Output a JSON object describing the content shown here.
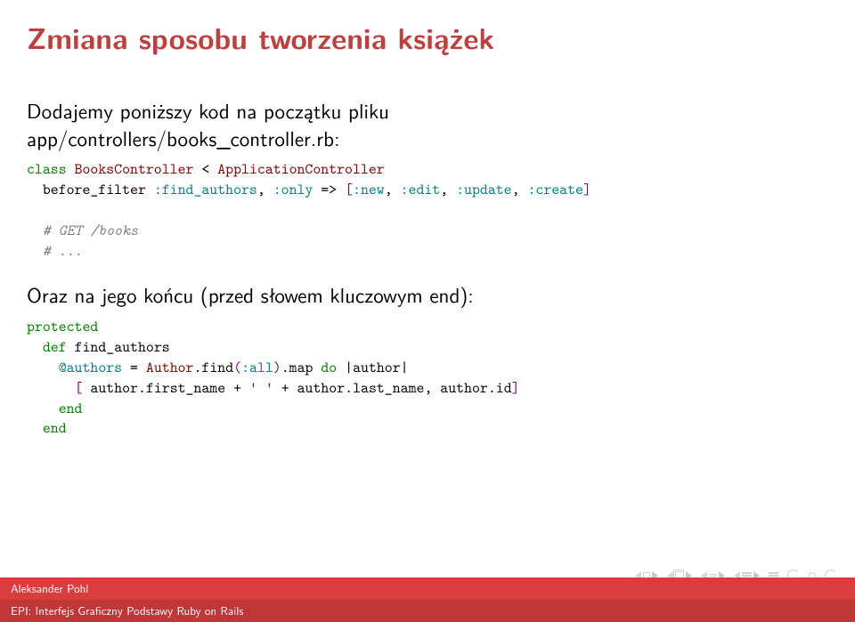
{
  "title": "Zmiana sposobu tworzenia książek",
  "intro": {
    "text": "Dodajemy poniższy kod na początku pliku",
    "path": "app/controllers/books_controller.rb:"
  },
  "code1": {
    "class_kw": "class",
    "class_name": "BooksController",
    "lt": "<",
    "parent": "ApplicationController",
    "before_filter": "before_filter",
    "find_authors": ":find_authors",
    "comma1": ",",
    "only": ":only",
    "arrow": "=>",
    "lbrack": "[",
    "new": ":new",
    "comma2": ",",
    "edit": ":edit",
    "comma3": ",",
    "update": ":update",
    "comma4": ",",
    "create": ":create",
    "rbrack": "]",
    "cmt1": "# GET /books",
    "cmt2": "# ..."
  },
  "intro2": "Oraz na jego końcu (przed słowem kluczowym end):",
  "code2": {
    "protected": "protected",
    "def": "def",
    "method": "find_authors",
    "at_authors": "@authors",
    "eq": "=",
    "author_cls": "Author",
    "dot1": ".",
    "find": "find",
    "lp1": "(",
    "all": ":all",
    "rp1": ")",
    "dot2": ".",
    "map": "map",
    "do": "do",
    "pipe1": "|",
    "author_var": "author",
    "pipe2": "|",
    "lb2": "[",
    "author2": "author",
    "dot3": ".",
    "first_name": "first_name",
    "plus1": "+",
    "sp": "' '",
    "plus2": "+",
    "author3": "author",
    "dot4": ".",
    "last_name": "last_name",
    "comma": ",",
    "author4": "author",
    "dot5": ".",
    "id": "id",
    "rb2": "]",
    "end1": "end",
    "end2": "end"
  },
  "footer": {
    "author": "Aleksander Pohl",
    "course": "EPI: Interfejs Graficzny Podstawy Ruby on Rails"
  }
}
